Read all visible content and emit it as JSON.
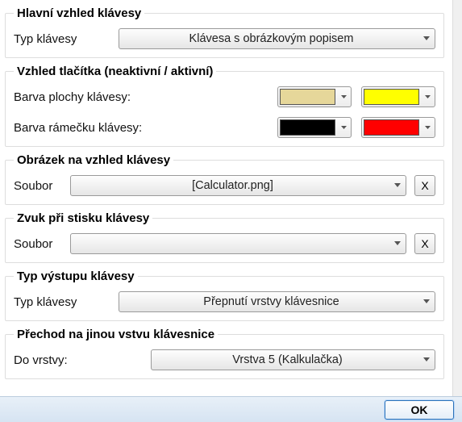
{
  "groups": {
    "main_look": {
      "legend": "Hlavní vzhled klávesy",
      "type_label": "Typ klávesy",
      "type_value": "Klávesa s obrázkovým popisem"
    },
    "button_look": {
      "legend": "Vzhled tlačítka (neaktivní / aktivní)",
      "fill_label": "Barva plochy klávesy:",
      "fill_inactive": "#e6d79a",
      "fill_active": "#ffff00",
      "frame_label": "Barva rámečku klávesy:",
      "frame_inactive": "#000000",
      "frame_active": "#ff0000"
    },
    "image": {
      "legend": "Obrázek na vzhled klávesy",
      "file_label": "Soubor",
      "file_value": "[Calculator.png]",
      "clear": "X"
    },
    "sound": {
      "legend": "Zvuk při stisku klávesy",
      "file_label": "Soubor",
      "file_value": "",
      "clear": "X"
    },
    "output": {
      "legend": "Typ výstupu klávesy",
      "type_label": "Typ klávesy",
      "type_value": "Přepnutí vrstvy klávesnice"
    },
    "layer": {
      "legend": "Přechod na jinou vstvu klávesnice",
      "to_label": "Do vrstvy:",
      "to_value": "Vrstva 5 (Kalkulačka)"
    }
  },
  "footer": {
    "ok": "OK"
  }
}
